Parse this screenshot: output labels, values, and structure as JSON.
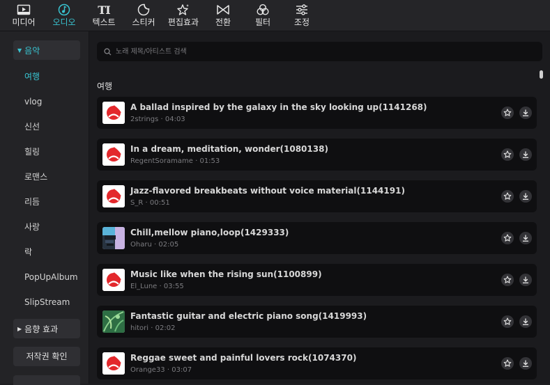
{
  "toolbar": [
    {
      "label": "미디어",
      "icon": "media-icon",
      "active": false
    },
    {
      "label": "오디오",
      "icon": "audio-icon",
      "active": true
    },
    {
      "label": "텍스트",
      "icon": "text-icon",
      "glyph": "TI",
      "active": false
    },
    {
      "label": "스티커",
      "icon": "sticker-icon",
      "active": false
    },
    {
      "label": "편집효과",
      "icon": "effects-icon",
      "active": false
    },
    {
      "label": "전환",
      "icon": "transition-icon",
      "active": false
    },
    {
      "label": "필터",
      "icon": "filter-icon",
      "active": false
    },
    {
      "label": "조정",
      "icon": "adjust-icon",
      "active": false
    }
  ],
  "sidebar": {
    "music_label": "음악",
    "items": [
      "여행",
      "vlog",
      "신선",
      "힐링",
      "로맨스",
      "리듬",
      "사랑",
      "락",
      "PopUpAlbum",
      "SlipStream"
    ],
    "active_item": "여행",
    "sound_effects_label": "음향 효과",
    "copyright_button": "저작권 확인"
  },
  "search": {
    "placeholder": "노래 제목/아티스트 검색"
  },
  "section_title": "여행",
  "tracks": [
    {
      "title": "A ballad inspired by the galaxy in the sky looking up(1141268)",
      "artist": "2strings",
      "duration": "04:03",
      "thumb": "logo"
    },
    {
      "title": "In a dream, meditation, wonder(1080138)",
      "artist": "RegentSoramame",
      "duration": "01:53",
      "thumb": "logo"
    },
    {
      "title": "Jazz-flavored breakbeats without voice material(1144191)",
      "artist": "S_R",
      "duration": "00:51",
      "thumb": "logo"
    },
    {
      "title": "Chill,mellow piano,loop(1429333)",
      "artist": "Oharu",
      "duration": "02:05",
      "thumb": "piano"
    },
    {
      "title": "Music like when the rising sun(1100899)",
      "artist": "El_Lune",
      "duration": "03:55",
      "thumb": "logo"
    },
    {
      "title": "Fantastic guitar and electric piano song(1419993)",
      "artist": "hitori",
      "duration": "02:02",
      "thumb": "leaves"
    },
    {
      "title": "Reggae sweet and painful lovers rock(1074370)",
      "artist": "Orange33",
      "duration": "03:07",
      "thumb": "logo"
    }
  ],
  "meta_separator": "·",
  "colors": {
    "accent": "#39c4d1",
    "logo_red": "#e3282c",
    "card_bg": "#0f0f11"
  }
}
